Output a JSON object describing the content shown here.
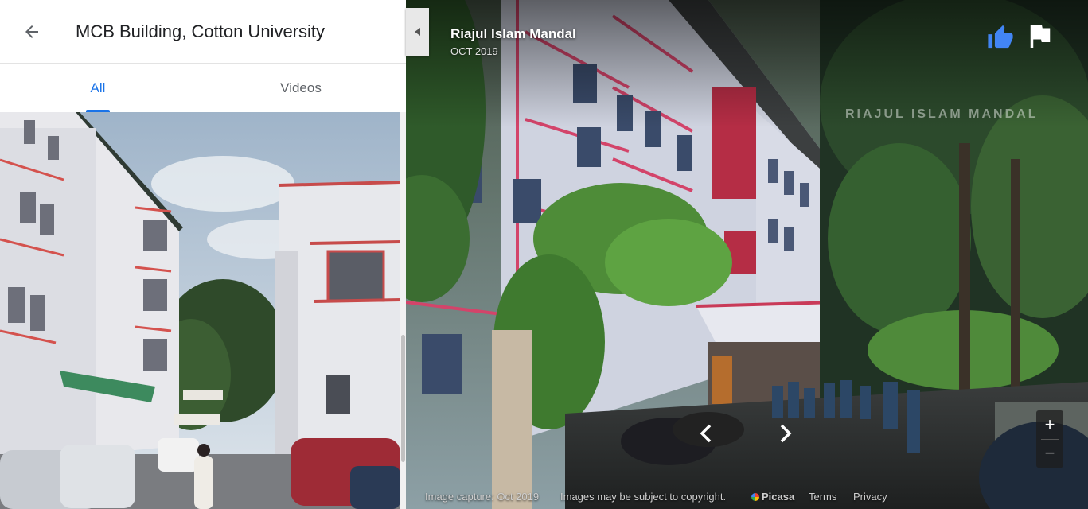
{
  "panel": {
    "title": "MCB Building, Cotton University",
    "back_icon": "arrow-back-icon",
    "tabs": [
      {
        "label": "All",
        "active": true
      },
      {
        "label": "Videos",
        "active": false
      }
    ],
    "accent_color": "#1a73e8"
  },
  "viewer": {
    "author": "Riajul Islam Mandal",
    "date": "OCT 2019",
    "watermark": "RIAJUL ISLAM MANDAL",
    "like_icon": "thumbs-up-icon",
    "like_color": "#4285f4",
    "flag_icon": "flag-icon",
    "zoom_in": "+",
    "zoom_out": "−"
  },
  "footer": {
    "capture": "Image capture: Oct 2019",
    "copyright": "Images may be subject to copyright.",
    "brand": "Picasa",
    "terms": "Terms",
    "privacy": "Privacy"
  }
}
